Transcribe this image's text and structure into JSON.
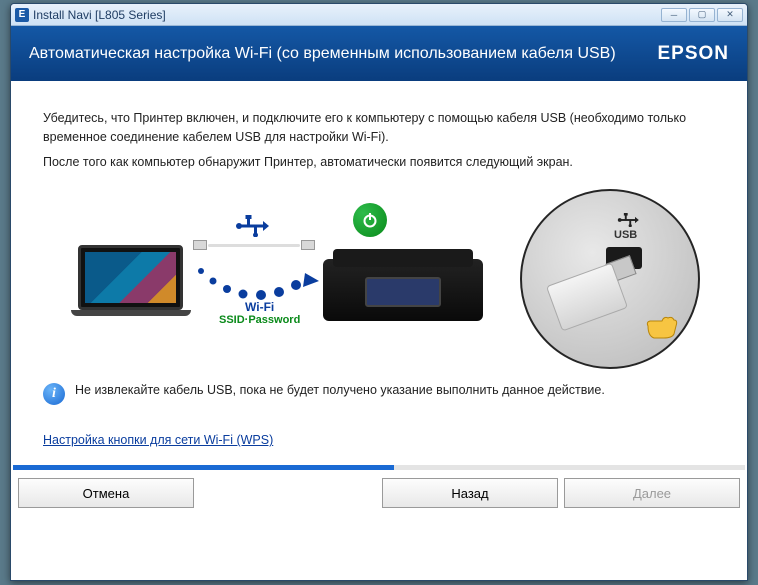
{
  "window": {
    "title": "Install Navi [L805 Series]"
  },
  "header": {
    "title": "Автоматическая настройка Wi-Fi (со временным использованием кабеля USB)",
    "brand": "EPSON"
  },
  "content": {
    "para1": "Убедитесь, что Принтер включен, и подключите его к компьютеру с помощью кабеля USB (необходимо только временное соединение кабелем USB для настройки Wi-Fi).",
    "para2": "После того как компьютер обнаружит Принтер, автоматически появится следующий экран.",
    "wifi_label": "Wi-Fi",
    "wifi_sub": "SSID·Password",
    "usb_label": "USB",
    "note": "Не извлекайте кабель USB, пока не будет получено указание выполнить данное действие.",
    "link": "Настройка кнопки для сети Wi-Fi (WPS)"
  },
  "buttons": {
    "cancel": "Отмена",
    "back": "Назад",
    "next": "Далее"
  },
  "progress_pct": 52
}
